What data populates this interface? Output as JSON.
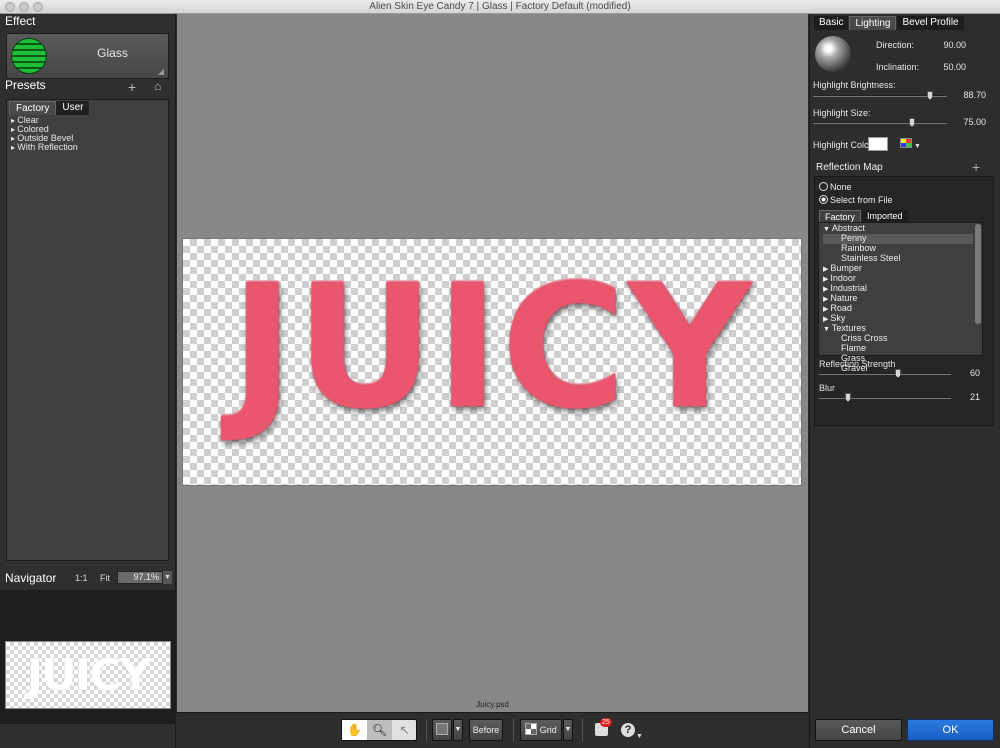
{
  "window": {
    "title": "Alien Skin Eye Candy 7 | Glass | Factory Default (modified)"
  },
  "left": {
    "effect_header": "Effect",
    "effect_name": "Glass",
    "presets_header": "Presets",
    "preset_tabs": [
      "Factory",
      "User"
    ],
    "preset_items": [
      "Clear",
      "Colored",
      "Outside Bevel",
      "With Reflection"
    ],
    "navigator": {
      "header": "Navigator",
      "one_to_one": "1:1",
      "fit": "Fit",
      "zoom": "97.1%",
      "thumb_text": "JUICY"
    }
  },
  "canvas": {
    "image_text": "JUICY",
    "filename": "Juicy.psd",
    "image_color": "#e9566e"
  },
  "toolbar": {
    "before_label": "Before",
    "grid_label": "Grid",
    "notification_count": "25",
    "help": "?"
  },
  "right": {
    "tabs": [
      "Basic",
      "Lighting",
      "Bevel Profile"
    ],
    "direction": {
      "label": "Direction:",
      "value": "90.00"
    },
    "inclination": {
      "label": "Inclination:",
      "value": "50.00"
    },
    "highlight_brightness": {
      "label": "Highlight Brightness:",
      "value": "88.70",
      "level": 0.887
    },
    "highlight_size": {
      "label": "Highlight Size:",
      "value": "75.00",
      "level": 0.75
    },
    "highlight_color": {
      "label": "Highlight Color",
      "color": "#ffffff"
    },
    "reflection_map": {
      "header": "Reflection Map",
      "radio_none": "None",
      "radio_file": "Select from File",
      "tabs": [
        "Factory",
        "Imported"
      ],
      "tree": [
        {
          "label": "Abstract",
          "expanded": true,
          "level": 0
        },
        {
          "label": "Penny",
          "level": 1,
          "selected": true
        },
        {
          "label": "Rainbow",
          "level": 1
        },
        {
          "label": "Stainless Steel",
          "level": 1
        },
        {
          "label": "Bumper",
          "level": 0
        },
        {
          "label": "Indoor",
          "level": 0
        },
        {
          "label": "Industrial",
          "level": 0
        },
        {
          "label": "Nature",
          "level": 0
        },
        {
          "label": "Road",
          "level": 0
        },
        {
          "label": "Sky",
          "level": 0
        },
        {
          "label": "Textures",
          "expanded": true,
          "level": 0
        },
        {
          "label": "Criss Cross",
          "level": 1
        },
        {
          "label": "Flame",
          "level": 1
        },
        {
          "label": "Grass",
          "level": 1
        },
        {
          "label": "Gravel",
          "level": 1
        }
      ],
      "strength": {
        "label": "Reflection Strength",
        "value": "60",
        "level": 0.6
      },
      "blur": {
        "label": "Blur",
        "value": "21",
        "level": 0.21
      }
    },
    "cancel_label": "Cancel",
    "ok_label": "OK"
  }
}
